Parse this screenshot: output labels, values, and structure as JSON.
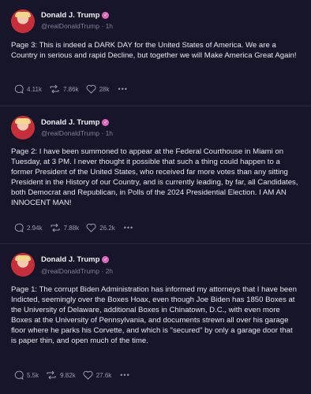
{
  "posts": [
    {
      "author": "Donald J. Trump",
      "handle": "@realDonaldTrump",
      "time": "1h",
      "text": "Page 3: This is indeed a DARK DAY for the United States of America. We are a Country in serious and rapid Decline, but together we will Make America Great Again!",
      "replies": "4.11k",
      "retruths": "7.86k",
      "likes": "28k"
    },
    {
      "author": "Donald J. Trump",
      "handle": "@realDonaldTrump",
      "time": "1h",
      "text": "Page 2: I have been summoned to appear at the Federal Courthouse in Miami on Tuesday, at 3 PM. I never thought it possible that such a thing could happen to a former President of the United States, who received far more votes than any sitting President in the History of our Country, and is currently leading, by far, all Candidates, both Democrat and Republican, in Polls of the 2024 Presidential Election. I AM AN INNOCENT MAN!",
      "replies": "2.94k",
      "retruths": "7.88k",
      "likes": "26.2k"
    },
    {
      "author": "Donald J. Trump",
      "handle": "@realDonaldTrump",
      "time": "2h",
      "text": "Page 1: The corrupt Biden Administration has informed my attorneys that I have been Indicted, seemingly over the Boxes Hoax, even though Joe Biden has 1850 Boxes at the University of Delaware, additional Boxes in Chinatown, D.C., with even more Boxes at the University of Pennsylvania, and documents strewn all over his garage floor where he parks his Corvette, and which is \"secured\" by only a garage door that is paper thin, and open much of the time.",
      "replies": "5.5k",
      "retruths": "9.82k",
      "likes": "27.6k"
    }
  ],
  "ui": {
    "separator": "·",
    "more": "•••",
    "verified_mark": "✓",
    "colors": {
      "background": "#16152a",
      "verified": "#e066b9",
      "muted": "#7f7f93"
    },
    "icons": [
      "avatar",
      "verified-badge-icon",
      "reply-icon",
      "retruth-icon",
      "like-icon",
      "more-icon"
    ]
  }
}
